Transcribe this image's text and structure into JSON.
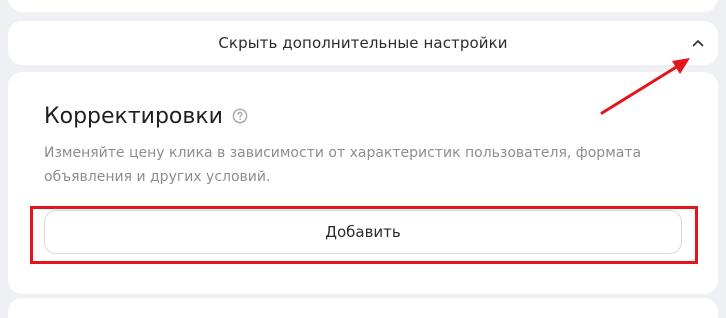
{
  "settings_toggle": {
    "label": "Скрыть дополнительные настройки",
    "icon": "chevron-up-icon"
  },
  "adjustments": {
    "title": "Корректировки",
    "help_icon": "question-circle-icon",
    "description": "Изменяйте цену клика в зависимости от характеристик пользователя, формата объявления и других условий.",
    "add_button_label": "Добавить"
  },
  "colors": {
    "page_background": "#eef0f3",
    "card_background": "#ffffff",
    "annotation_red": "#e3141b",
    "muted_text": "#8c8e94"
  }
}
